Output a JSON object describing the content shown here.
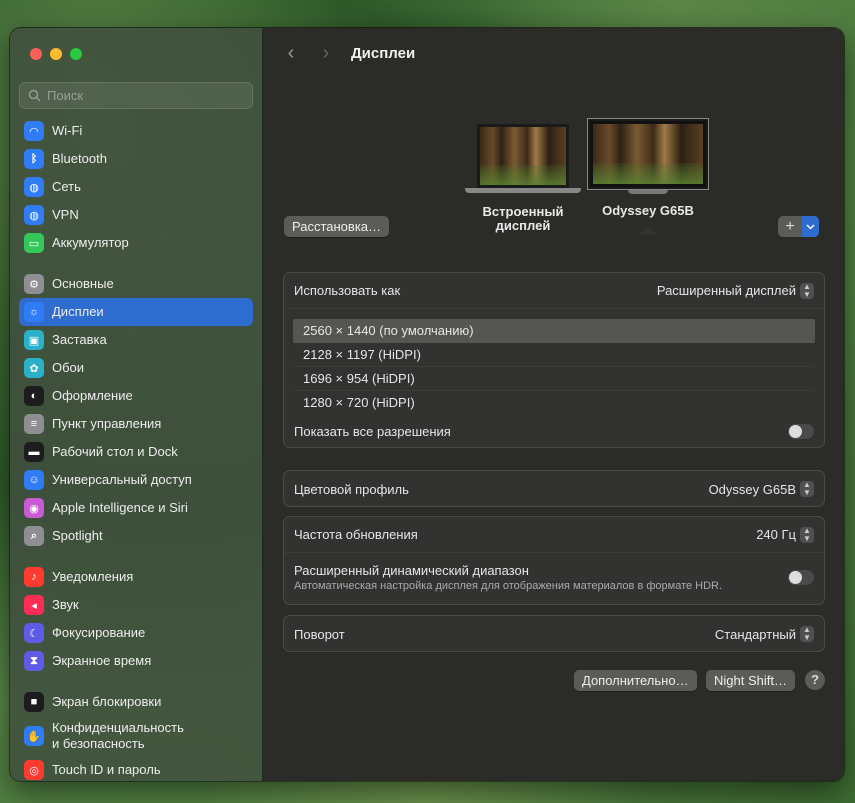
{
  "search": {
    "placeholder": "Поиск"
  },
  "sidebar": {
    "items": [
      {
        "label": "Wi-Fi",
        "icon": "wifi-icon",
        "color": "#2f7cf6"
      },
      {
        "label": "Bluetooth",
        "icon": "bluetooth-icon",
        "color": "#2f7cf6"
      },
      {
        "label": "Сеть",
        "icon": "globe-icon",
        "color": "#2f7cf6"
      },
      {
        "label": "VPN",
        "icon": "vpn-globe-icon",
        "color": "#2f7cf6"
      },
      {
        "label": "Аккумулятор",
        "icon": "battery-icon",
        "color": "#34c759"
      },
      {
        "label": "Основные",
        "icon": "gear-icon",
        "color": "#8e8e93"
      },
      {
        "label": "Дисплеи",
        "icon": "sun-icon",
        "color": "#2f7cf6"
      },
      {
        "label": "Заставка",
        "icon": "screensaver-icon",
        "color": "#2ab0c8"
      },
      {
        "label": "Обои",
        "icon": "flower-icon",
        "color": "#2ab0c8"
      },
      {
        "label": "Оформление",
        "icon": "appearance-icon",
        "color": "#1c1c1e"
      },
      {
        "label": "Пункт управления",
        "icon": "control-center-icon",
        "color": "#8e8e93"
      },
      {
        "label": "Рабочий стол и Dock",
        "icon": "dock-icon",
        "color": "#1c1c1e"
      },
      {
        "label": "Универсальный доступ",
        "icon": "accessibility-icon",
        "color": "#2f7cf6"
      },
      {
        "label": "Apple Intelligence и Siri",
        "icon": "siri-icon",
        "color": "#c85ad6"
      },
      {
        "label": "Spotlight",
        "icon": "magnifier-icon",
        "color": "#8e8e93"
      },
      {
        "label": "Уведомления",
        "icon": "bell-icon",
        "color": "#ff3b30"
      },
      {
        "label": "Звук",
        "icon": "speaker-icon",
        "color": "#ff2d55"
      },
      {
        "label": "Фокусирование",
        "icon": "moon-icon",
        "color": "#5e5ce6"
      },
      {
        "label": "Экранное время",
        "icon": "hourglass-icon",
        "color": "#5e5ce6"
      },
      {
        "label": "Экран блокировки",
        "icon": "lock-icon",
        "color": "#1c1c1e"
      },
      {
        "label": "Конфиденциальность\nи безопасность",
        "icon": "hand-icon",
        "color": "#2f7cf6"
      },
      {
        "label": "Touch ID и пароль",
        "icon": "fingerprint-icon",
        "color": "#ff3b30"
      }
    ]
  },
  "header": {
    "title": "Дисплеи"
  },
  "displays": {
    "arrange_button": "Расстановка…",
    "builtin_label": "Встроенный\nдисплей",
    "external_label": "Odyssey G65B",
    "add_button": "+"
  },
  "use_as": {
    "label": "Использовать как",
    "value": "Расширенный дисплей"
  },
  "resolutions": [
    "2560 × 1440 (по умолчанию)",
    "2128 × 1197 (HiDPI)",
    "1696 × 954 (HiDPI)",
    "1280 × 720 (HiDPI)"
  ],
  "show_all": {
    "label": "Показать все разрешения"
  },
  "color_profile": {
    "label": "Цветовой профиль",
    "value": "Odyssey G65B"
  },
  "refresh": {
    "label": "Частота обновления",
    "value": "240 Гц"
  },
  "hdr": {
    "label": "Расширенный динамический диапазон",
    "sub": "Автоматическая настройка дисплея для отображения материалов в формате HDR."
  },
  "rotation": {
    "label": "Поворот",
    "value": "Стандартный"
  },
  "footer": {
    "advanced": "Дополнительно…",
    "night_shift": "Night Shift…",
    "help": "?"
  }
}
